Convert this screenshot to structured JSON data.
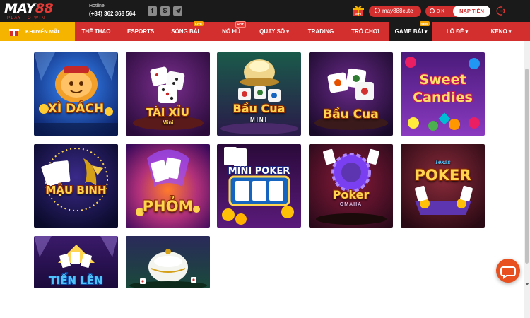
{
  "brand": {
    "logo_prefix": "MAY",
    "logo_suffix": "88",
    "tagline": "PLAY TO WIN"
  },
  "header": {
    "hotline_label": "Hotline",
    "hotline_number": "(+84) 362 368 564",
    "social_icons": [
      "facebook-icon",
      "skype-icon",
      "telegram-icon"
    ],
    "gift_label": "GIFT",
    "username": "may888cute",
    "balance": "0 K",
    "deposit_label": "NẠP TIỀN"
  },
  "nav": {
    "promo": "KHUYẾN MÃI",
    "items": [
      {
        "label": "THỂ THAO",
        "badge": ""
      },
      {
        "label": "ESPORTS",
        "badge": ""
      },
      {
        "label": "SÒNG BÀI",
        "badge": "LIVE"
      },
      {
        "label": "NỔ HŨ",
        "badge": "HOT"
      },
      {
        "label": "QUAY SỐ",
        "badge": ""
      },
      {
        "label": "TRADING",
        "badge": ""
      },
      {
        "label": "TRÒ CHƠI",
        "badge": ""
      },
      {
        "label": "GAME BÀI",
        "badge": "NEW"
      },
      {
        "label": "LÔ ĐỀ",
        "badge": ""
      },
      {
        "label": "KENO",
        "badge": ""
      }
    ],
    "active": "GAME BÀI"
  },
  "games": [
    {
      "title": "XÌ DÁCH",
      "sub": ""
    },
    {
      "title": "TÀI XỈU",
      "sub": "Mini"
    },
    {
      "title": "Bầu Cua",
      "sub": "MINI"
    },
    {
      "title": "Bầu Cua",
      "sub": ""
    },
    {
      "title": "Sweet",
      "sub": "Candies"
    },
    {
      "title": "MẬU BINH",
      "sub": ""
    },
    {
      "title": "PHỎM",
      "sub": ""
    },
    {
      "title": "MINI POKER",
      "sub": ""
    },
    {
      "title": "Poker",
      "sub": "OMAHA"
    },
    {
      "title": "POKER",
      "sub": "Texas"
    },
    {
      "title": "TIẾN LÊN",
      "sub": ""
    },
    {
      "title": "",
      "sub": ""
    }
  ],
  "colors": {
    "brand_red": "#d32f2f",
    "promo_yellow": "#f4b400",
    "topbar": "#1a1a1a",
    "chat_orange": "#e8501f"
  }
}
